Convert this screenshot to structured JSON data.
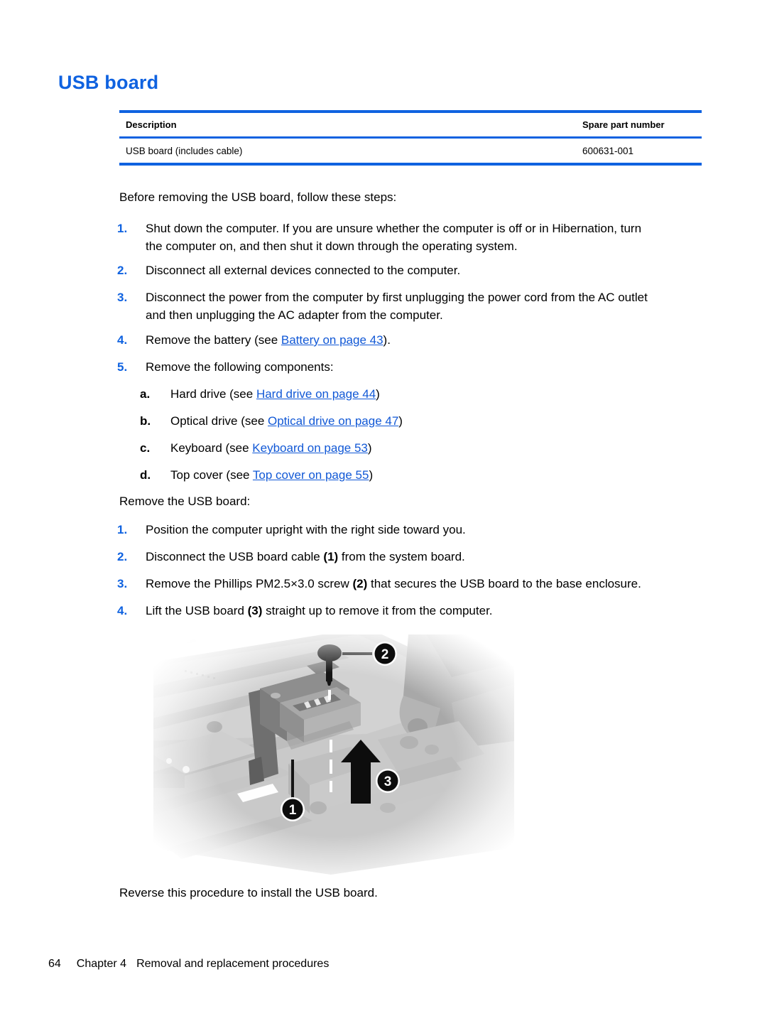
{
  "heading": "USB board",
  "colors": {
    "accent_blue": "#0f62e0",
    "link_blue": "#1158d6",
    "text_black": "#000000"
  },
  "parts_table": {
    "columns": [
      "Description",
      "Spare part number"
    ],
    "rows": [
      {
        "description": "USB board (includes cable)",
        "spare_part_number": "600631-001"
      }
    ]
  },
  "before_section": {
    "lead": "Before removing the USB board, follow these steps:",
    "steps": [
      {
        "marker": "1.",
        "line1": "Shut down the computer. If you are unsure whether the computer is off or in Hibernation, turn",
        "line2": "the computer on, and then shut it down through the operating system."
      },
      {
        "marker": "2.",
        "line1": "Disconnect all external devices connected to the computer.",
        "line2": ""
      },
      {
        "marker": "3.",
        "line1": "Disconnect the power from the computer by first unplugging the power cord from the AC outlet",
        "line2": "and then unplugging the AC adapter from the computer."
      },
      {
        "marker": "4.",
        "text_before": "Remove the battery (see ",
        "link": "Battery on page 43",
        "text_after": ")."
      },
      {
        "marker": "5.",
        "line1": "Remove the following components:",
        "line2": ""
      }
    ],
    "substeps": [
      {
        "marker": "a.",
        "text_before": "Hard drive (see ",
        "link": "Hard drive on page 44",
        "text_after": ")"
      },
      {
        "marker": "b.",
        "text_before": "Optical drive (see ",
        "link": "Optical drive on page 47",
        "text_after": ")"
      },
      {
        "marker": "c.",
        "text_before": "Keyboard (see ",
        "link": "Keyboard on page 53",
        "text_after": ")"
      },
      {
        "marker": "d.",
        "text_before": "Top cover (see ",
        "link": "Top cover on page 55",
        "text_after": ")"
      }
    ]
  },
  "remove_section": {
    "lead": "Remove the USB board:",
    "steps": [
      {
        "marker": "1.",
        "pre": "Position the computer upright with the right side toward you.",
        "callout": "",
        "post": ""
      },
      {
        "marker": "2.",
        "pre": "Disconnect the USB board cable ",
        "callout": "(1)",
        "post": " from the system board."
      },
      {
        "marker": "3.",
        "pre": "Remove the Phillips PM2.5×3.0 screw ",
        "callout": "(2)",
        "post": " that secures the USB board to the base enclosure."
      },
      {
        "marker": "4.",
        "pre": "Lift the USB board ",
        "callout": "(3)",
        "post": " straight up to remove it from the computer."
      }
    ]
  },
  "figure": {
    "caption_alt": "Grayscale photo of laptop base enclosure showing USB board removal",
    "callouts": [
      {
        "id": "1",
        "label": "1",
        "refers_to": "USB board cable"
      },
      {
        "id": "2",
        "label": "2",
        "refers_to": "Phillips PM2.5x3.0 screw"
      },
      {
        "id": "3",
        "label": "3",
        "refers_to": "Lift direction of USB board"
      }
    ]
  },
  "closing": "Reverse this procedure to install the USB board.",
  "footer": {
    "page_number": "64",
    "chapter": "Chapter 4",
    "chapter_title": "Removal and replacement procedures"
  }
}
